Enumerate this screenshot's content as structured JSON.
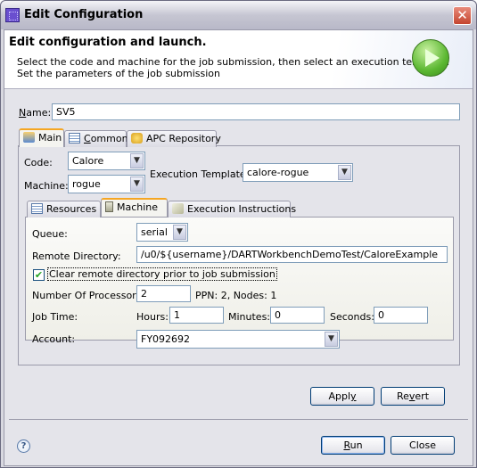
{
  "window": {
    "title": "Edit Configuration",
    "close_label": "✕"
  },
  "header": {
    "title": "Edit configuration and launch.",
    "description_line1": "Select the code and machine for the job submission, then select an execution template.",
    "description_line2": "Set the parameters of the job submission"
  },
  "name_field": {
    "label_prefix": "N",
    "label_rest": "ame:",
    "value": "SV5"
  },
  "outer_tabs": [
    {
      "label": "Main",
      "icon": "main-icon",
      "active": true
    },
    {
      "label_prefix": "C",
      "label_rest": "ommon",
      "icon": "common-icon",
      "active": false
    },
    {
      "label": "APC Repository",
      "icon": "apc-repository-icon",
      "active": false
    }
  ],
  "main_tab": {
    "code_label": "Code:",
    "code_value": "Calore",
    "machine_label": "Machine:",
    "machine_value": "rogue",
    "template_label": "Execution Template:",
    "template_value": "calore-rogue"
  },
  "inner_tabs": [
    {
      "label": "Resources",
      "icon": "resources-icon",
      "active": false
    },
    {
      "label": "Machine",
      "icon": "machine-icon",
      "active": true
    },
    {
      "label": "Execution Instructions",
      "icon": "execution-instructions-icon",
      "active": false
    }
  ],
  "machine_tab": {
    "queue_label": "Queue:",
    "queue_value": "serial",
    "remote_dir_label": "Remote Directory:",
    "remote_dir_value": "/u0/${username}/DARTWorkbenchDemoTest/CaloreExample",
    "clear_dir_label": "Clear remote directory prior to job submission",
    "clear_dir_checked": true,
    "check_mark": "✔",
    "processors_label": "Number Of Processors:",
    "processors_value": "2",
    "ppn_info": "PPN: 2, Nodes: 1",
    "job_time_label": "Job Time:",
    "hours_label": "Hours:",
    "hours_value": "1",
    "minutes_label": "Minutes:",
    "minutes_value": "0",
    "seconds_label": "Seconds:",
    "seconds_value": "0",
    "account_label": "Account:",
    "account_value": "FY092692"
  },
  "buttons": {
    "apply_prefix": "Appl",
    "apply_accel": "y",
    "revert_prefix": "Re",
    "revert_accel": "v",
    "revert_suffix": "ert",
    "run_accel": "R",
    "run_rest": "un",
    "close": "Close",
    "help": "?"
  },
  "combo_arrow": "▼"
}
